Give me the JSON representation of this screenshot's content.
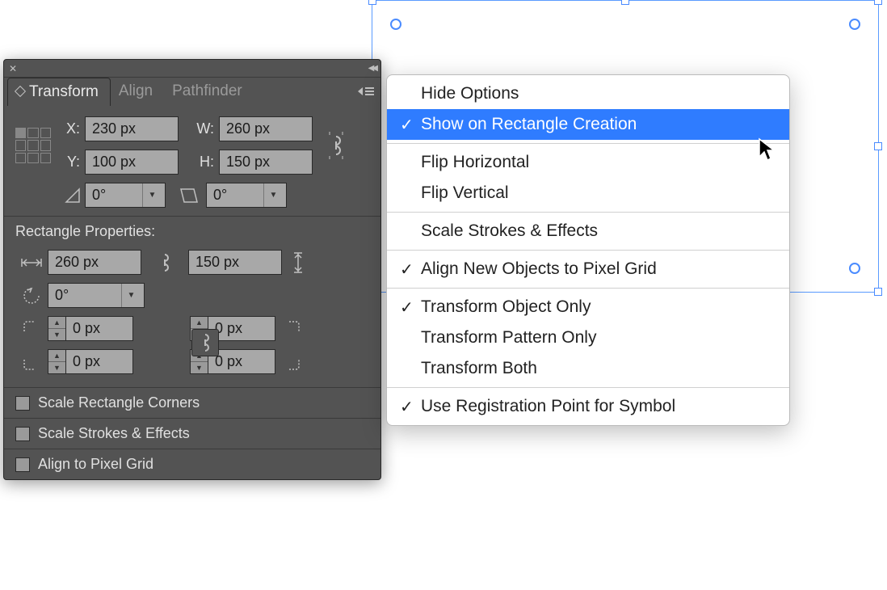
{
  "tabs": {
    "transform": "Transform",
    "align": "Align",
    "pathfinder": "Pathfinder"
  },
  "fields": {
    "x_label": "X:",
    "x": "230 px",
    "y_label": "Y:",
    "y": "100 px",
    "w_label": "W:",
    "w": "260 px",
    "h_label": "H:",
    "h": "150 px",
    "rotate": "0°",
    "shear": "0°"
  },
  "rect_section": "Rectangle Properties:",
  "rect": {
    "width": "260 px",
    "height": "150 px",
    "angle": "0°",
    "tl": "0 px",
    "tr": "0 px",
    "bl": "0 px",
    "br": "0 px"
  },
  "checks": {
    "scale_corners": "Scale Rectangle Corners",
    "scale_strokes": "Scale Strokes & Effects",
    "align_grid": "Align to Pixel Grid"
  },
  "menu": {
    "hide_options": "Hide Options",
    "show_on_rect": "Show on Rectangle Creation",
    "flip_h": "Flip Horizontal",
    "flip_v": "Flip Vertical",
    "scale_strokes": "Scale Strokes & Effects",
    "align_pixel": "Align New Objects to Pixel Grid",
    "t_obj": "Transform Object Only",
    "t_pat": "Transform Pattern Only",
    "t_both": "Transform Both",
    "reg_point": "Use Registration Point for Symbol"
  }
}
